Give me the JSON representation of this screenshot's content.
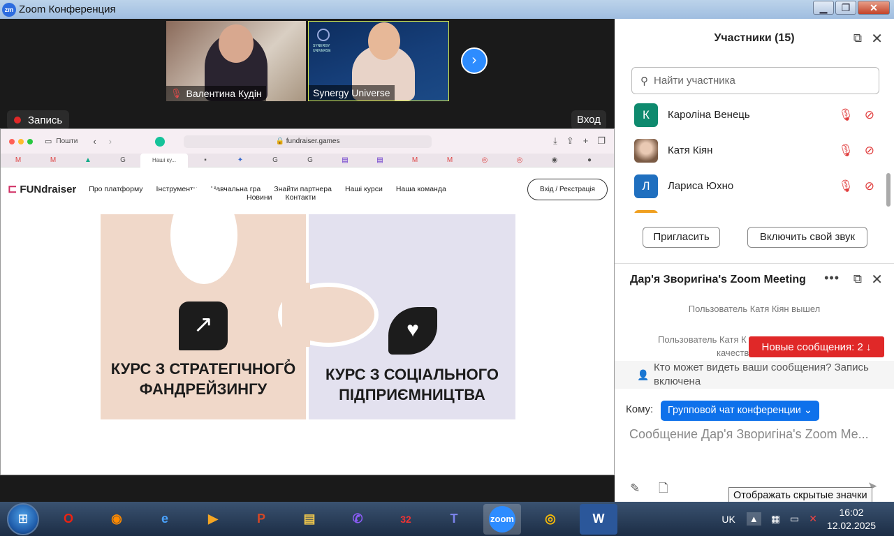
{
  "window": {
    "title": "Zoom Конференция",
    "icon_label": "zm",
    "minimize": "▁",
    "maximize": "❐",
    "close": "✕"
  },
  "videos": [
    {
      "name": "Валентина Кудін",
      "muted": true
    },
    {
      "name": "Synergy Universe",
      "muted": false,
      "logo_text": "SYNERGY UNIVERSE"
    }
  ],
  "next_label": "›",
  "recording_label": "Запись",
  "enter_label": "Вход",
  "browser": {
    "sidebar_label": "Пошти",
    "url": "fundraiser.games",
    "active_tab": "Наші ку...",
    "site": {
      "logo": "FUNdraiser",
      "menu": [
        "Про платформу",
        "Інструменти",
        "Навчальна гра",
        "Знайти партнера",
        "Наші курси",
        "Наша команда"
      ],
      "menu2": [
        "Новини",
        "Контакти"
      ],
      "login": "Вхід / Реєстрація"
    },
    "courses": [
      {
        "title_line1": "КУРС З СТРАТЕГІЧНОГО",
        "title_line2": "ФАНДРЕЙЗИНГУ"
      },
      {
        "title_line1": "КУРС З СОЦІАЛЬНОГО",
        "title_line2": "ПІДПРИЄМНИЦТВА"
      }
    ]
  },
  "participants": {
    "title": "Участники (15)",
    "search_placeholder": "Найти участника",
    "list": [
      {
        "initial": "К",
        "name": "Кароліна Венець",
        "color": "#0e8a6e"
      },
      {
        "initial": "",
        "name": "Катя Кіян",
        "color": "#c9a38a"
      },
      {
        "initial": "Л",
        "name": "Лариса Юхно",
        "color": "#1f6fbf"
      }
    ],
    "invite": "Пригласить",
    "unmute": "Включить свой звук"
  },
  "chat": {
    "title": "Дар'я Зворигіна's Zoom Meeting",
    "sys1": "Пользователь Катя Кіян вышел",
    "sys2a": "Пользователь Катя К",
    "sys2b": "качеств",
    "new_messages": "Новые сообщения: 2 ↓",
    "visibility": "Кто может видеть ваши сообщения? Запись включена",
    "to_label": "Кому:",
    "to_value": "Групповой чат конференции ⌄",
    "placeholder": "Сообщение Дар'я Зворигіна's Zoom Me..."
  },
  "tooltip": "Отображать скрытые значки",
  "taskbar": {
    "lang": "UK",
    "time": "16:02",
    "date": "12.02.2025",
    "badge": "32",
    "zoom_label": "zoom",
    "word_label": "W",
    "powerpoint_label": "P"
  }
}
